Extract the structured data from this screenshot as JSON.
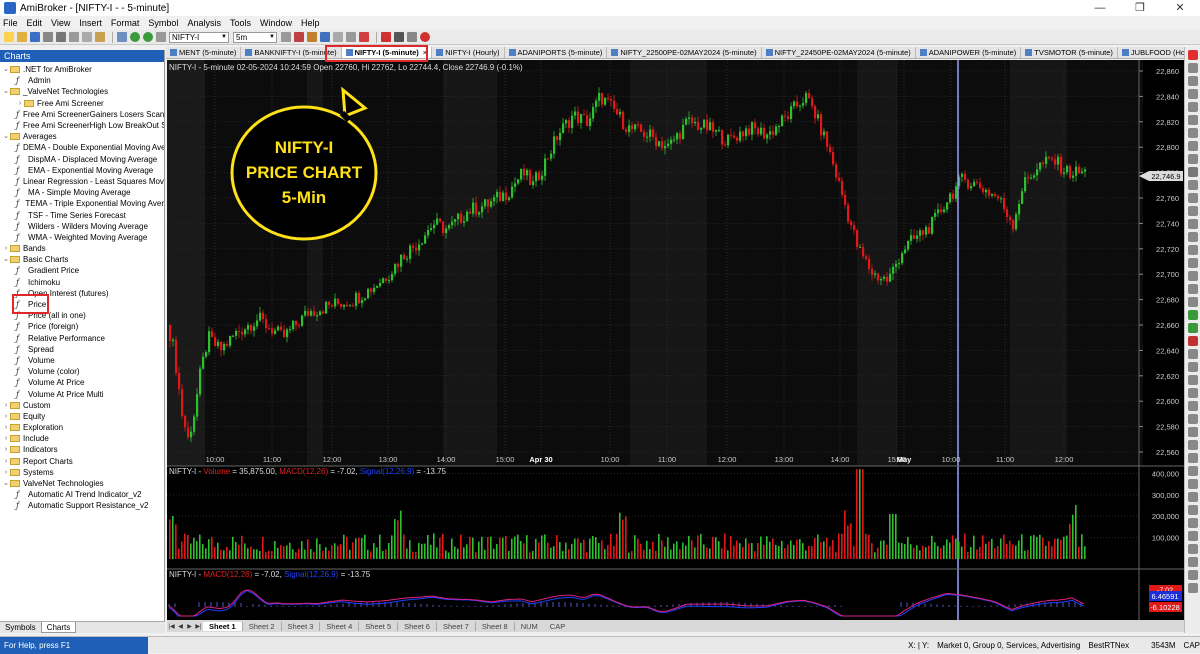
{
  "window": {
    "title": "AmiBroker - [NIFTY-I -  - 5-minute]",
    "controls": [
      "—",
      "❐",
      "✕"
    ]
  },
  "menu": [
    "File",
    "Edit",
    "View",
    "Insert",
    "Format",
    "Symbol",
    "Analysis",
    "Tools",
    "Window",
    "Help"
  ],
  "toolbar": {
    "symbol": "NIFTY-I",
    "interval": "5m"
  },
  "charts_panel": {
    "title": "Charts",
    "tree": [
      {
        "level": 0,
        "type": "folder",
        "open": true,
        "label": ".NET for AmiBroker"
      },
      {
        "level": 1,
        "type": "formula",
        "label": "Admin"
      },
      {
        "level": 0,
        "type": "folder",
        "open": true,
        "label": "_ValveNet Technologies"
      },
      {
        "level": 1,
        "type": "folder",
        "label": "Free Ami Screener"
      },
      {
        "level": 1,
        "type": "formula",
        "label": "Free Ami ScreenerGainers Losers Scann"
      },
      {
        "level": 1,
        "type": "formula",
        "label": "Free Ami ScreenerHigh Low BreakOut S"
      },
      {
        "level": 0,
        "type": "folder",
        "open": true,
        "label": "Averages"
      },
      {
        "level": 1,
        "type": "formula",
        "label": "DEMA - Double Exponential Moving Ave"
      },
      {
        "level": 1,
        "type": "formula",
        "label": "DispMA - Displaced Moving Average"
      },
      {
        "level": 1,
        "type": "formula",
        "label": "EMA - Exponential Moving Average"
      },
      {
        "level": 1,
        "type": "formula",
        "label": "Linear Regression - Least Squares Movi"
      },
      {
        "level": 1,
        "type": "formula",
        "label": "MA - Simple Moving Average"
      },
      {
        "level": 1,
        "type": "formula",
        "label": "TEMA - Triple Exponential Moving Aver"
      },
      {
        "level": 1,
        "type": "formula",
        "label": "TSF - Time Series Forecast"
      },
      {
        "level": 1,
        "type": "formula",
        "label": "Wilders - Wilders Moving Average"
      },
      {
        "level": 1,
        "type": "formula",
        "label": "WMA - Weighted Moving Average"
      },
      {
        "level": 0,
        "type": "folder",
        "open": false,
        "label": "Bands"
      },
      {
        "level": 0,
        "type": "folder",
        "open": true,
        "label": "Basic Charts"
      },
      {
        "level": 1,
        "type": "formula",
        "label": "Gradient Price"
      },
      {
        "level": 1,
        "type": "formula",
        "label": "Ichimoku"
      },
      {
        "level": 1,
        "type": "formula",
        "label": "Open Interest (futures)"
      },
      {
        "level": 1,
        "type": "formula",
        "label": "Price"
      },
      {
        "level": 1,
        "type": "formula",
        "label": "Price (all in one)"
      },
      {
        "level": 1,
        "type": "formula",
        "label": "Price (foreign)"
      },
      {
        "level": 1,
        "type": "formula",
        "label": "Relative Performance"
      },
      {
        "level": 1,
        "type": "formula",
        "label": "Spread"
      },
      {
        "level": 1,
        "type": "formula",
        "label": "Volume"
      },
      {
        "level": 1,
        "type": "formula",
        "label": "Volume (color)"
      },
      {
        "level": 1,
        "type": "formula",
        "label": "Volume At Price"
      },
      {
        "level": 1,
        "type": "formula",
        "label": "Volume At Price Multi"
      },
      {
        "level": 0,
        "type": "folder",
        "open": false,
        "label": "Custom"
      },
      {
        "level": 0,
        "type": "folder",
        "open": false,
        "label": "Equity"
      },
      {
        "level": 0,
        "type": "folder",
        "open": false,
        "label": "Exploration"
      },
      {
        "level": 0,
        "type": "folder",
        "open": false,
        "label": "Include"
      },
      {
        "level": 0,
        "type": "folder",
        "open": false,
        "label": "Indicators"
      },
      {
        "level": 0,
        "type": "folder",
        "open": false,
        "label": "Report Charts"
      },
      {
        "level": 0,
        "type": "folder",
        "open": false,
        "label": "Systems"
      },
      {
        "level": 0,
        "type": "folder",
        "open": true,
        "label": "ValveNet Technologies"
      },
      {
        "level": 1,
        "type": "formula",
        "label": "Automatic AI Trend Indicator_v2"
      },
      {
        "level": 1,
        "type": "formula",
        "label": "Automatic Support Resistance_v2"
      }
    ],
    "tabs": [
      "Symbols",
      "Charts"
    ]
  },
  "doc_tabs": [
    {
      "label": "MENT (5-minute)",
      "active": false
    },
    {
      "label": "BANKNIFTY-I (5-minute)",
      "active": false
    },
    {
      "label": "NIFTY-I (5-minute)",
      "active": true
    },
    {
      "label": "NIFTY-I (Hourly)",
      "active": false
    },
    {
      "label": "ADANIPORTS (5-minute)",
      "active": false
    },
    {
      "label": "NIFTY_22500PE-02MAY2024 (5-minute)",
      "active": false
    },
    {
      "label": "NIFTY_22450PE-02MAY2024 (5-minute)",
      "active": false
    },
    {
      "label": "ADANIPOWER (5-minute)",
      "active": false
    },
    {
      "label": "TVSMOTOR (5-minute)",
      "active": false
    },
    {
      "label": "JUBLFOOD (Hourly)",
      "active": false
    }
  ],
  "price_pane": {
    "header": "NIFTY-I - 5-minute 02-05-2024 10:24:59 Open 22760, Hi 22762, Lo 22744.4, Close 22746.9 (-0.1%)",
    "last_price_label": "22,746.9",
    "y_ticks": [
      "22,860",
      "22,840",
      "22,820",
      "22,800",
      "22,780",
      "22,760",
      "22,740",
      "22,720",
      "22,700",
      "22,680",
      "22,660",
      "22,640",
      "22,620",
      "22,600",
      "22,580",
      "22,560"
    ],
    "x_ticks": [
      "10:00",
      "11:00",
      "12:00",
      "13:00",
      "14:00",
      "15:00",
      "Apr 30",
      "10:00",
      "11:00",
      "12:00",
      "13:00",
      "14:00",
      "15:00",
      "May",
      "10:00",
      "11:00",
      "12:00"
    ]
  },
  "volume_pane": {
    "header_symbol": "NIFTY-I - ",
    "header_volume_label": "Volume",
    "header_volume_value": " = 35,875.00, ",
    "header_macd_label": "MACD(12,26)",
    "header_macd_value": " = -7.02, ",
    "header_signal_label": "Signal(12,26,9)",
    "header_signal_value": " = -13.75",
    "y_ticks": [
      "400,000",
      "300,000",
      "200,000",
      "100,000"
    ],
    "value_label": "-7.02"
  },
  "macd_pane": {
    "header_symbol": "NIFTY-I - ",
    "header_macd_label": "MACD(12,26)",
    "header_macd_value": " = -7.02, ",
    "header_signal_label": "Signal(12,26,9)",
    "header_signal_value": " = -13.75",
    "label_blue": "6.46591",
    "label_red": "-6.10228"
  },
  "callout": {
    "lines": [
      "NIFTY-I",
      "PRICE CHART",
      "5-Min"
    ]
  },
  "sheets": [
    "Sheet 1",
    "Sheet 2",
    "Sheet 3",
    "Sheet 4",
    "Sheet 5",
    "Sheet 6",
    "Sheet 7",
    "Sheet 8"
  ],
  "sheet_extra": [
    "NUM",
    "CAP"
  ],
  "status": {
    "left": "For Help, press F1",
    "coords": "X: | Y:",
    "market": "Market 0, Group 0, Services, Advertising",
    "source": "BestRTNex",
    "memory": "3543M",
    "cap": "CAP"
  },
  "colors": {
    "up": "#2fbf2f",
    "down": "#e01818",
    "callout": "#ffe11a",
    "highlight": "#e0282b",
    "panel": "#1f5fb7"
  }
}
